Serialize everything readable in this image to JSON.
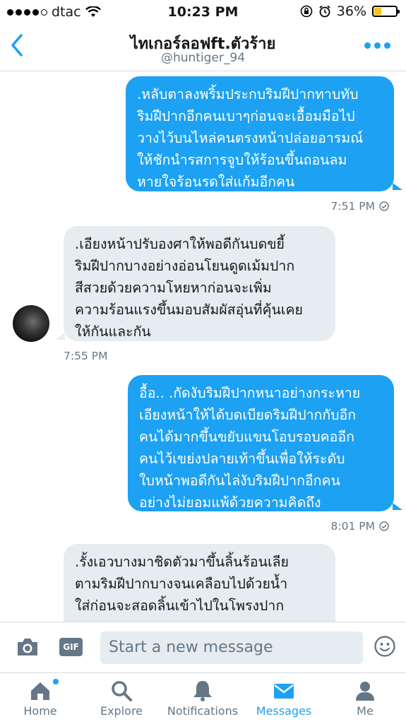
{
  "status_bar": {
    "carrier": "dtac",
    "time": "10:23 PM",
    "battery": "36%",
    "battery_level": 0.36
  },
  "header": {
    "title": "ไทเกอร์ลอฟft.ตัวร้าย",
    "handle": "@huntiger_94",
    "back_icon": "chevron-left-icon",
    "more_icon": "more-dots-icon"
  },
  "messages": [
    {
      "direction": "outgoing",
      "lines": [
        ".หลับตาลงพริ้มประกบริมฝีปากทาบทับ",
        "ริมฝีปากอีกคนเบาๆก่อนจะเอื้อมมือไป",
        "วางไว้บนไหล่คนตรงหน้าปล่อยอารมณ์",
        "ให้ชักนำรสการจูบให้ร้อนขึ้นถอนลม",
        "หายใจร้อนรดใส่แก้มอีกคน"
      ],
      "time": "7:51 PM"
    },
    {
      "direction": "incoming",
      "lines": [
        ".เอียงหน้าปรับองศาให้พอดีกันบดขยี้",
        "ริมฝีปากบางอย่างอ่อนโยนดูดเม้มปาก",
        "สีสวยด้วยความโหยหาก่อนจะเพิ่ม",
        "ความร้อนแรงขึ้นมอบสัมผัสอุ่นที่คุ้นเคย",
        "ให้กันและกัน"
      ],
      "time": "7:55 PM"
    },
    {
      "direction": "outgoing",
      "lines": [
        "อื้อ.. .กัดงับริมฝีปากหนาอย่างกระหาย",
        "เอียงหน้าให้ได้บดเบียดริมฝีปากกับอีก",
        "คนได้มากขึ้นขยับแขนโอบรอบคออีก",
        "คนไว้เขย่งปลายเท้าขึ้นเพื่อให้ระดับ",
        "ใบหน้าพอดีกันไล่งับริมฝีปากอีกคน",
        "อย่างไม่ยอมแพ้ด้วยความคิดถึง"
      ],
      "time": "8:01 PM"
    },
    {
      "direction": "incoming",
      "lines": [
        ".รั้งเอวบางมาชิดตัวมาขึ้นลิ้นร้อนเลีย",
        "ตามริมฝีปากบางจนเคลือบไปด้วยน้ำ",
        "ใส่ก่อนจะสอดลิ้นเข้าไปในโพรงปาก"
      ]
    }
  ],
  "compose": {
    "placeholder": "Start a new message",
    "gif_label": "GIF",
    "camera_icon": "camera-icon",
    "emoji_icon": "emoji-icon"
  },
  "tabs": [
    {
      "label": "Home",
      "icon": "home-icon"
    },
    {
      "label": "Explore",
      "icon": "search-icon"
    },
    {
      "label": "Notifications",
      "icon": "bell-icon"
    },
    {
      "label": "Messages",
      "icon": "envelope-icon"
    },
    {
      "label": "Me",
      "icon": "person-icon"
    }
  ],
  "colors": {
    "accent": "#1da1f2",
    "incoming_bubble": "#e6ecf0",
    "muted_text": "#657786"
  }
}
